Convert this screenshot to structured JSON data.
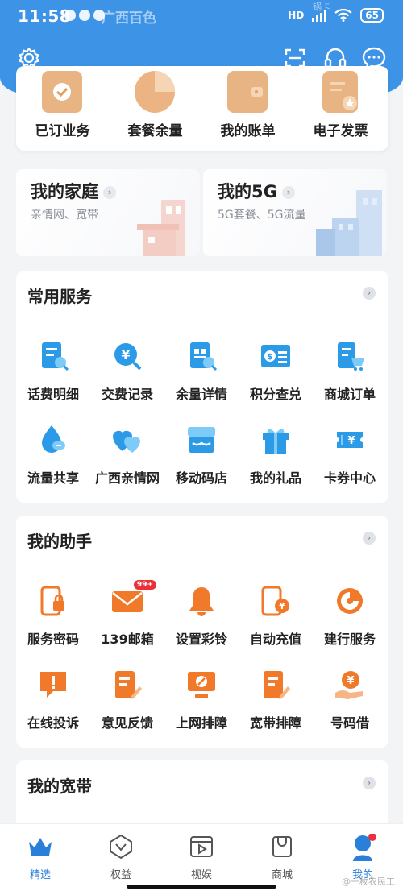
{
  "status_bar": {
    "time": "11:58",
    "app_label": "广西百色",
    "network": "HD",
    "battery": "65",
    "watermark": "锅卡"
  },
  "header": {
    "icons": [
      "gear-icon",
      "scan-icon",
      "headset-icon",
      "chat-icon"
    ]
  },
  "top_shortcuts": [
    {
      "label": "已订业务",
      "icon": "subscribed-icon"
    },
    {
      "label": "套餐余量",
      "icon": "pie-chart-icon"
    },
    {
      "label": "我的账单",
      "icon": "wallet-icon"
    },
    {
      "label": "电子发票",
      "icon": "invoice-icon"
    }
  ],
  "family": {
    "title": "我的家庭",
    "subtitle": "亲情网、宽带"
  },
  "five_g": {
    "title": "我的5G",
    "subtitle": "5G套餐、5G流量"
  },
  "common_services": {
    "title": "常用服务",
    "items": [
      {
        "label": "话费明细",
        "icon": "bill-detail-icon"
      },
      {
        "label": "交费记录",
        "icon": "payment-record-icon"
      },
      {
        "label": "余量详情",
        "icon": "balance-detail-icon"
      },
      {
        "label": "积分查兑",
        "icon": "points-icon"
      },
      {
        "label": "商城订单",
        "icon": "mall-order-icon"
      },
      {
        "label": "流量共享",
        "icon": "data-share-icon"
      },
      {
        "label": "广西亲情网",
        "icon": "family-net-icon"
      },
      {
        "label": "移动码店",
        "icon": "store-icon"
      },
      {
        "label": "我的礼品",
        "icon": "gift-icon"
      },
      {
        "label": "卡券中心",
        "icon": "coupon-icon"
      }
    ]
  },
  "assistant": {
    "title": "我的助手",
    "items": [
      {
        "label": "服务密码",
        "icon": "service-password-icon"
      },
      {
        "label": "139邮箱",
        "icon": "mail-icon",
        "badge": "99+"
      },
      {
        "label": "设置彩铃",
        "icon": "bell-icon"
      },
      {
        "label": "自动充值",
        "icon": "auto-recharge-icon"
      },
      {
        "label": "建行服务",
        "icon": "ccb-icon"
      },
      {
        "label": "在线投诉",
        "icon": "complaint-icon"
      },
      {
        "label": "意见反馈",
        "icon": "feedback-icon"
      },
      {
        "label": "上网排障",
        "icon": "network-fix-icon"
      },
      {
        "label": "宽带排障",
        "icon": "broadband-fix-icon"
      },
      {
        "label": "号码借",
        "icon": "number-loan-icon"
      }
    ]
  },
  "broadband": {
    "title": "我的宽带"
  },
  "bottom_nav": [
    {
      "label": "精选",
      "icon": "crown-icon"
    },
    {
      "label": "权益",
      "icon": "benefit-icon"
    },
    {
      "label": "视娱",
      "icon": "video-icon"
    },
    {
      "label": "商城",
      "icon": "shop-icon"
    },
    {
      "label": "我的",
      "icon": "profile-icon"
    }
  ],
  "watermark": "@一枚农民工",
  "colors": {
    "brand_blue": "#3d93e6",
    "icon_blue": "#2b9be8",
    "icon_orange": "#f07a2a",
    "badge_red": "#e8313b"
  }
}
